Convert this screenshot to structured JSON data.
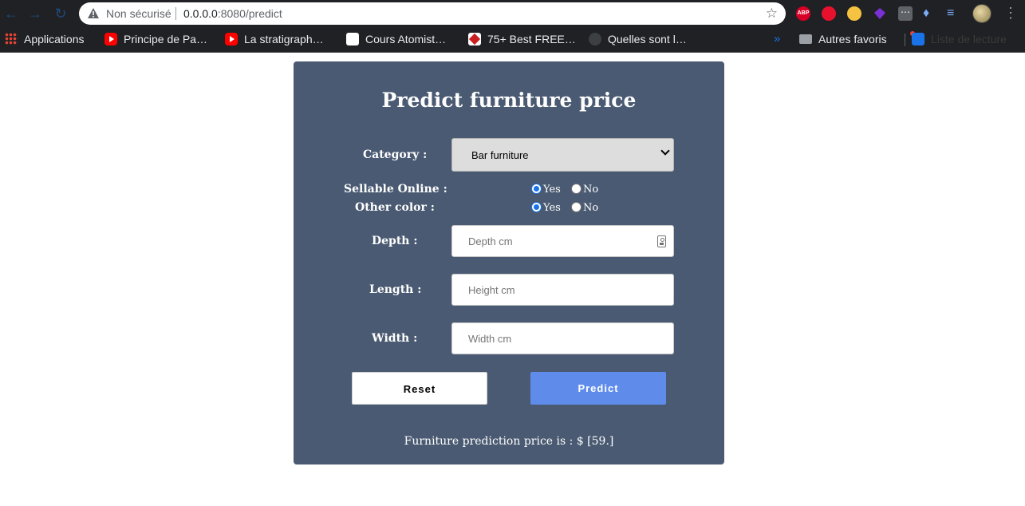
{
  "browser": {
    "security_label": "Non sécurisé",
    "url_host": "0.0.0.0",
    "url_rest": ":8080/predict",
    "extensions": {
      "abp_label": "ABP"
    },
    "bookmarks": [
      {
        "label": "Applications",
        "icon": "apps-icon"
      },
      {
        "label": "Principe de Pa…",
        "icon": "youtube-icon"
      },
      {
        "label": "La stratigraph…",
        "icon": "youtube-icon"
      },
      {
        "label": "Cours Atomist…",
        "icon": "cours-icon"
      },
      {
        "label": "75+ Best FREE…",
        "icon": "site-icon"
      },
      {
        "label": "Quelles sont l…",
        "icon": "site-icon"
      }
    ],
    "overflow_label": "»",
    "other_bookmarks": "Autres favoris",
    "reading_list": "Liste de lecture"
  },
  "page": {
    "title": "Predict furniture price",
    "category_label": "Category :",
    "category_value": "Bar furniture",
    "sellable_label": "Sellable Online :",
    "other_color_label": "Other color :",
    "yes_label": "Yes",
    "no_label": "No",
    "sellable_selected": "Yes",
    "other_color_selected": "Yes",
    "depth_label": "Depth :",
    "depth_placeholder": "Depth cm",
    "length_label": "Length :",
    "length_placeholder": "Height cm",
    "width_label": "Width :",
    "width_placeholder": "Width cm",
    "reset_label": "Reset",
    "predict_label": "Predict",
    "result_text": "Furniture prediction price is : $ [59.]"
  },
  "colors": {
    "card_bg": "#4a5a72",
    "predict_button": "#5f8ceb",
    "browser_chrome": "#202124"
  }
}
